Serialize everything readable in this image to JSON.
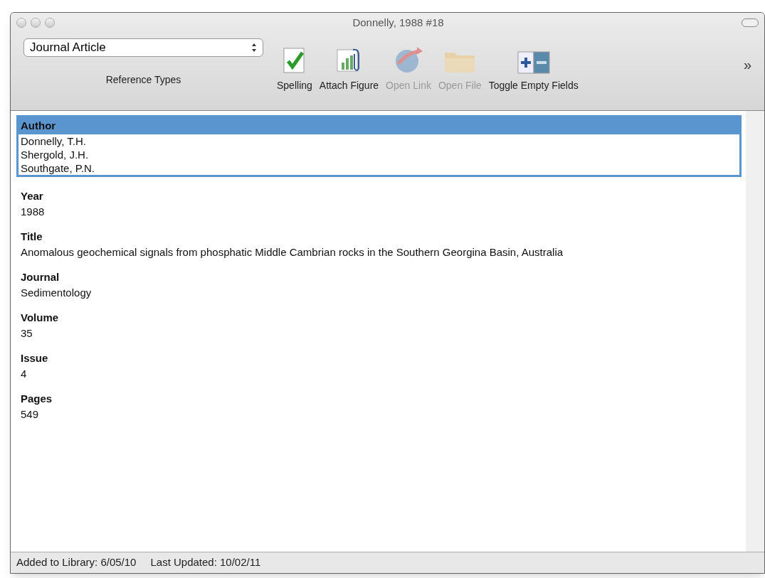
{
  "window": {
    "title": "Donnelly, 1988 #18"
  },
  "toolbar": {
    "reference_type": {
      "value": "Journal Article",
      "label": "Reference Types"
    },
    "items": [
      {
        "kind": "spelling",
        "label": "Spelling",
        "disabled": false
      },
      {
        "kind": "figure",
        "label": "Attach Figure",
        "disabled": false
      },
      {
        "kind": "link",
        "label": "Open Link",
        "disabled": true
      },
      {
        "kind": "file",
        "label": "Open File",
        "disabled": true
      },
      {
        "kind": "toggle",
        "label": "Toggle Empty Fields",
        "disabled": false
      }
    ],
    "overflow": "»"
  },
  "fields": [
    {
      "label": "Author",
      "values": [
        "Donnelly, T.H.",
        "Shergold, J.H.",
        "Southgate, P.N."
      ],
      "selected": true
    },
    {
      "label": "Year",
      "values": [
        "1988"
      ],
      "selected": false
    },
    {
      "label": "Title",
      "values": [
        "Anomalous geochemical signals from phosphatic Middle Cambrian rocks in the Southern Georgina Basin, Australia"
      ],
      "selected": false
    },
    {
      "label": "Journal",
      "values": [
        "Sedimentology"
      ],
      "selected": false
    },
    {
      "label": "Volume",
      "values": [
        "35"
      ],
      "selected": false
    },
    {
      "label": "Issue",
      "values": [
        "4"
      ],
      "selected": false
    },
    {
      "label": "Pages",
      "values": [
        "549"
      ],
      "selected": false
    }
  ],
  "status_bar": {
    "added": "Added to Library: 6/05/10",
    "updated": "Last Updated: 10/02/11"
  }
}
